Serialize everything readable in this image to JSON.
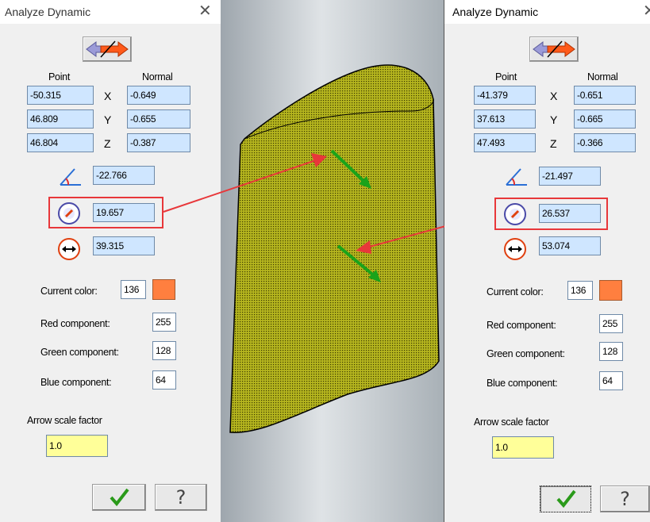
{
  "left": {
    "title": "Analyze Dynamic",
    "close_glyph": "✕",
    "point_header": "Point",
    "normal_header": "Normal",
    "axes": [
      "X",
      "Y",
      "Z"
    ],
    "point": [
      "-50.315",
      "46.809",
      "46.804"
    ],
    "normal": [
      "-0.649",
      "-0.655",
      "-0.387"
    ],
    "angle": "-22.766",
    "radius": "19.657",
    "diameter": "39.315",
    "current_color_label": "Current color:",
    "current_color": "136",
    "red_label": "Red component:",
    "red": "255",
    "green_label": "Green component:",
    "green": "128",
    "blue_label": "Blue component:",
    "blue": "64",
    "arrow_scale_label": "Arrow scale factor",
    "arrow_scale": "1.0",
    "help_glyph": "?"
  },
  "right": {
    "title": "Analyze Dynamic",
    "close_glyph": "✕",
    "point_header": "Point",
    "normal_header": "Normal",
    "axes": [
      "X",
      "Y",
      "Z"
    ],
    "point": [
      "-41.379",
      "37.613",
      "47.493"
    ],
    "normal": [
      "-0.651",
      "-0.665",
      "-0.366"
    ],
    "angle": "-21.497",
    "radius": "26.537",
    "diameter": "53.074",
    "current_color_label": "Current color:",
    "current_color": "136",
    "red_label": "Red component:",
    "red": "255",
    "green_label": "Green component:",
    "green": "128",
    "blue_label": "Blue component:",
    "blue": "64",
    "arrow_scale_label": "Arrow scale factor",
    "arrow_scale": "1.0",
    "help_glyph": "?"
  },
  "colors": {
    "swatch": "#ff7f3f",
    "field_bg": "#cfe6ff",
    "scale_field_bg": "#ffff99",
    "highlight": "#e8373a",
    "surface": "#b5b51e",
    "normal_arrow": "#1aa31a"
  },
  "icons": [
    "flip-normal-icon",
    "angle-icon",
    "radius-icon",
    "diameter-icon",
    "checkmark-icon",
    "help-icon",
    "close-icon"
  ]
}
